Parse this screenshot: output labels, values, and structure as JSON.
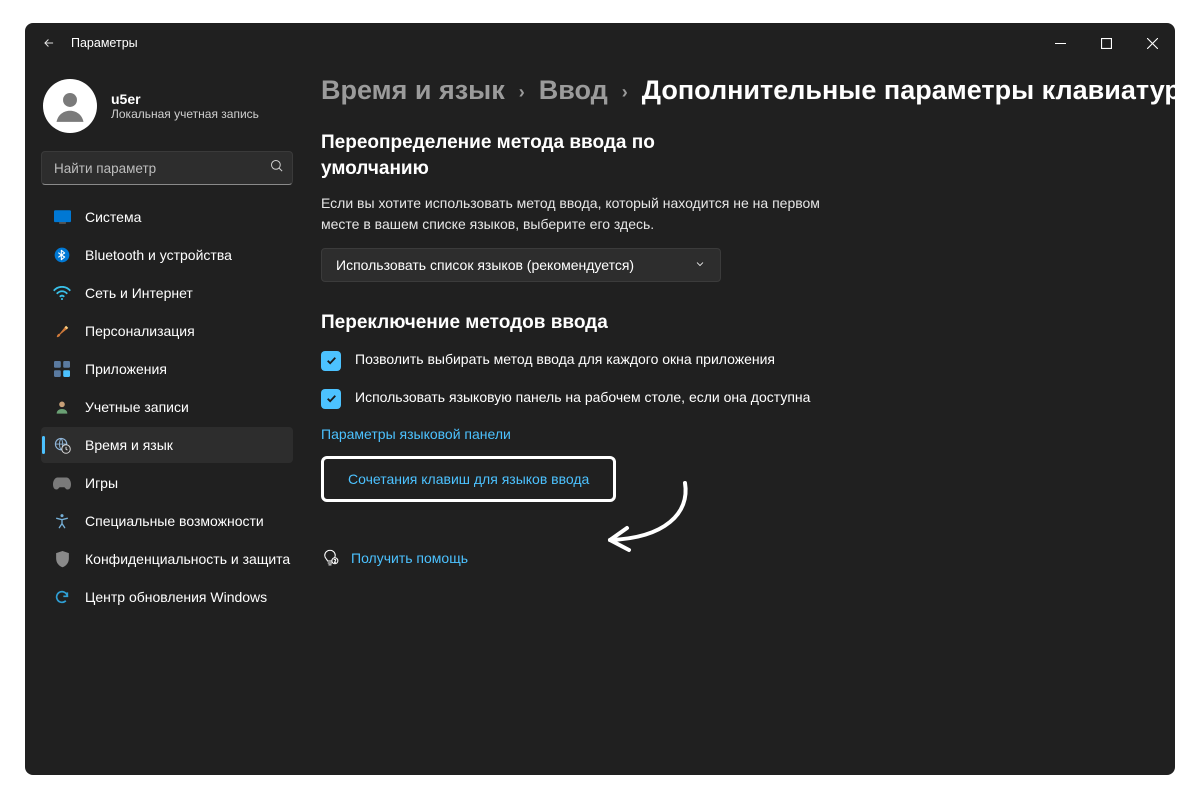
{
  "titlebar": {
    "title": "Параметры"
  },
  "user": {
    "name": "u5er",
    "sub": "Локальная учетная запись"
  },
  "search": {
    "placeholder": "Найти параметр"
  },
  "sidebar": {
    "items": [
      {
        "label": "Система"
      },
      {
        "label": "Bluetooth и устройства"
      },
      {
        "label": "Сеть и Интернет"
      },
      {
        "label": "Персонализация"
      },
      {
        "label": "Приложения"
      },
      {
        "label": "Учетные записи"
      },
      {
        "label": "Время и язык"
      },
      {
        "label": "Игры"
      },
      {
        "label": "Специальные возможности"
      },
      {
        "label": "Конфиденциальность и защита"
      },
      {
        "label": "Центр обновления Windows"
      }
    ]
  },
  "breadcrumb": {
    "a": "Время и язык",
    "b": "Ввод",
    "c": "Дополнительные параметры клавиатуры"
  },
  "main": {
    "section1_title": "Переопределение метода ввода по умолчанию",
    "section1_hint": "Если вы хотите использовать метод ввода, который находится не на первом месте в вашем списке языков, выберите его здесь.",
    "dropdown_value": "Использовать список языков (рекомендуется)",
    "section2_title": "Переключение методов ввода",
    "check1": "Позволить выбирать метод ввода для каждого окна приложения",
    "check2": "Использовать языковую панель на рабочем столе, если она доступна",
    "link1": "Параметры языковой панели",
    "link2": "Сочетания клавиш для языков ввода",
    "help": "Получить помощь"
  }
}
